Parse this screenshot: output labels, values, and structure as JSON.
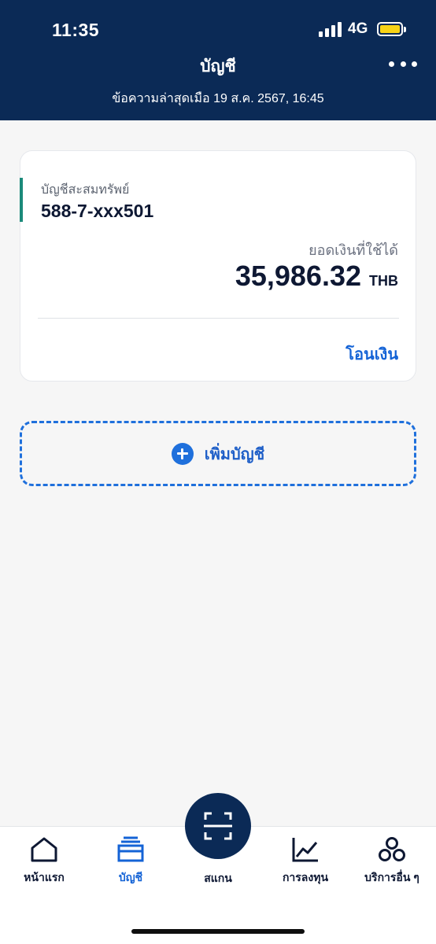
{
  "status_bar": {
    "time": "11:35",
    "network": "4G",
    "battery_color": "#f8d316"
  },
  "header": {
    "title": "บัญชี",
    "subtitle": "ข้อความล่าสุดเมือ 19 ส.ค. 2567, 16:45",
    "more_icon": "more-horizontal-icon",
    "background": "#0b2a56"
  },
  "account_card": {
    "account_type": "บัญชีสะสมทรัพย์",
    "account_number": "588-7-xxx501",
    "balance_label": "ยอดเงินที่ใช้ได้",
    "balance_amount": "35,986.32",
    "currency": "THB",
    "transfer_label": "โอนเงิน",
    "accent_color": "#1b8a7a"
  },
  "add_account": {
    "label": "เพิ่มบัญชี",
    "icon": "plus-circle-icon",
    "color": "#1f70dc"
  },
  "bottom_nav": {
    "items": [
      {
        "label": "หน้าแรก",
        "icon": "home-icon",
        "active": false
      },
      {
        "label": "บัญชี",
        "icon": "wallet-icon",
        "active": true
      },
      {
        "label": "สแกน",
        "icon": "scan-icon",
        "active": false
      },
      {
        "label": "การลงทุน",
        "icon": "line-chart-icon",
        "active": false
      },
      {
        "label": "บริการอื่น ๆ",
        "icon": "more-services-icon",
        "active": false
      }
    ],
    "active_color": "#1463d6"
  }
}
